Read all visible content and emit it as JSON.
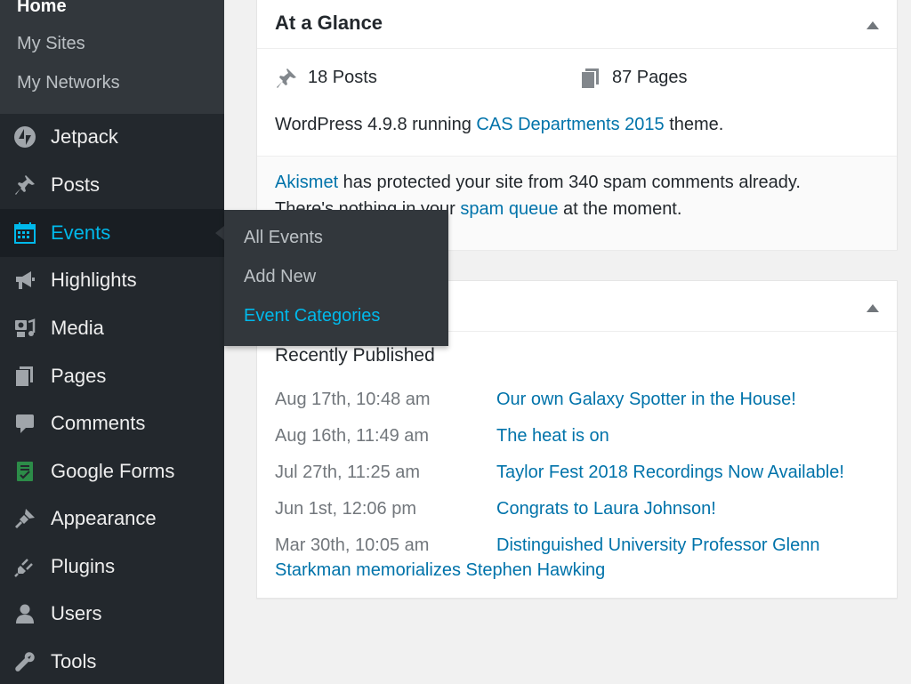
{
  "sidebar": {
    "my_sites_submenu": [
      {
        "label": "Home"
      },
      {
        "label": "My Sites"
      },
      {
        "label": "My Networks"
      }
    ],
    "menu": [
      {
        "label": "Jetpack",
        "icon": "jetpack-icon"
      },
      {
        "label": "Posts",
        "icon": "pushpin-icon"
      },
      {
        "label": "Events",
        "icon": "calendar-icon"
      },
      {
        "label": "Highlights",
        "icon": "megaphone-icon"
      },
      {
        "label": "Media",
        "icon": "media-icon"
      },
      {
        "label": "Pages",
        "icon": "pages-icon"
      },
      {
        "label": "Comments",
        "icon": "comment-icon"
      },
      {
        "label": "Google Forms",
        "icon": "google-forms-icon"
      },
      {
        "label": "Appearance",
        "icon": "paintbrush-icon"
      },
      {
        "label": "Plugins",
        "icon": "plug-icon"
      },
      {
        "label": "Users",
        "icon": "user-icon"
      },
      {
        "label": "Tools",
        "icon": "wrench-icon"
      }
    ],
    "active": "Events"
  },
  "flyout": {
    "items": [
      {
        "label": "All Events"
      },
      {
        "label": "Add New"
      },
      {
        "label": "Event Categories"
      }
    ],
    "current": "Event Categories"
  },
  "glance": {
    "title": "At a Glance",
    "posts": "18 Posts",
    "pages": "87 Pages",
    "version_prefix": "WordPress 4.9.8 running ",
    "theme": "CAS Departments 2015",
    "version_suffix": " theme.",
    "akismet_link": "Akismet",
    "akismet_text": " has protected your site from 340 spam comments already.",
    "spam_prefix": "There's nothing in your ",
    "spam_link": "spam queue",
    "spam_suffix": " at the moment."
  },
  "activity": {
    "section": "Recently Published",
    "items": [
      {
        "date": "Aug 17th, 10:48 am",
        "title": "Our own Galaxy Spotter in the House!"
      },
      {
        "date": "Aug 16th, 11:49 am",
        "title": "The heat is on"
      },
      {
        "date": "Jul 27th, 11:25 am",
        "title": "Taylor Fest 2018 Recordings Now Available!"
      },
      {
        "date": "Jun 1st, 12:06 pm",
        "title": "Congrats to Laura Johnson!"
      },
      {
        "date": "Mar 30th, 10:05 am",
        "title": "Distinguished University Professor Glenn",
        "title_cont": "Starkman memorializes Stephen Hawking"
      }
    ]
  },
  "colors": {
    "sidebar_bg": "#23282d",
    "submenu_bg": "#32373c",
    "accent": "#00b9eb",
    "link": "#0073aa"
  }
}
